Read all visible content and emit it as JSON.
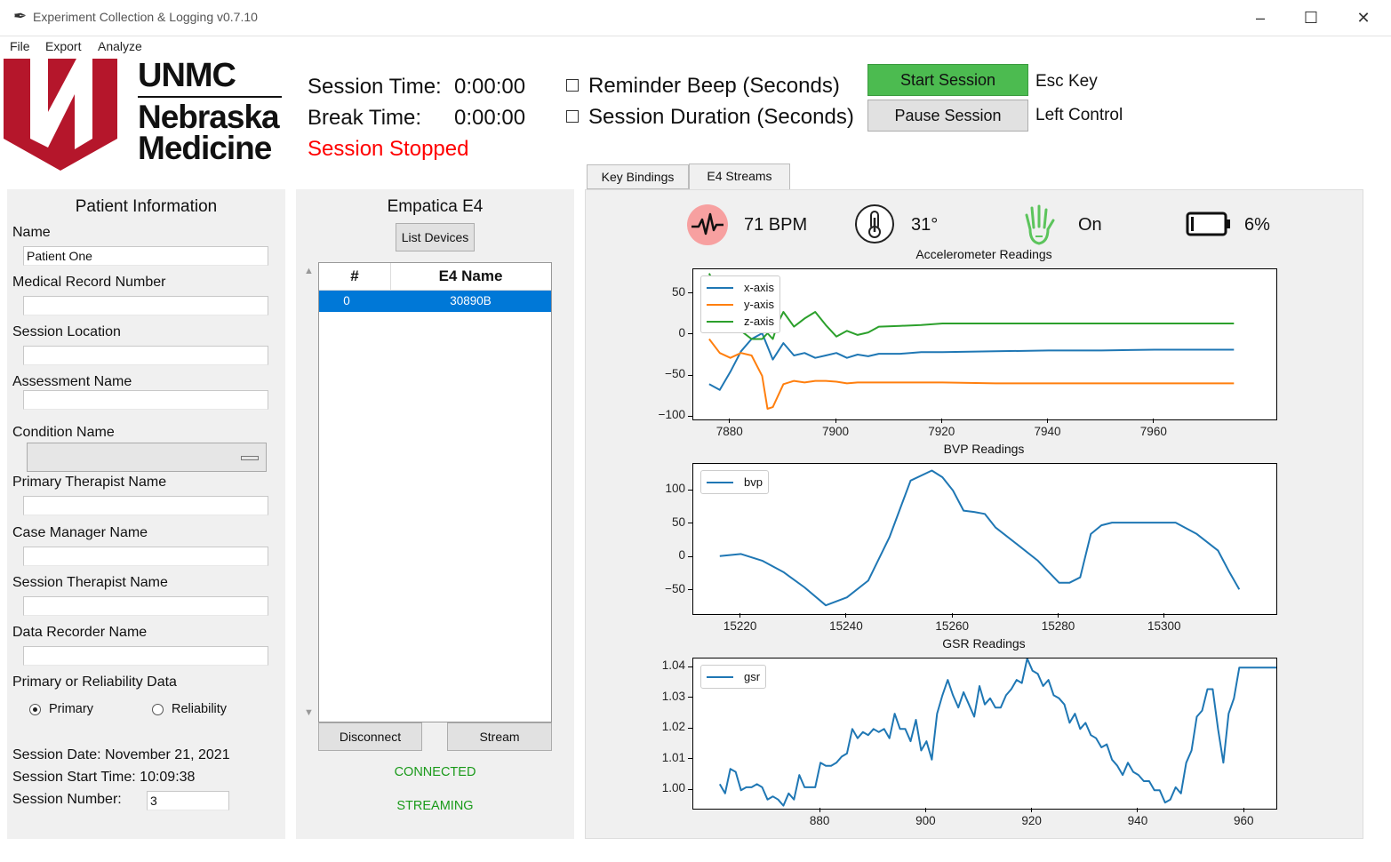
{
  "window": {
    "title": "Experiment Collection & Logging v0.7.10"
  },
  "menu": [
    "File",
    "Export",
    "Analyze"
  ],
  "logo": {
    "line1": "UNMC",
    "line2": "Nebraska",
    "line3": "Medicine",
    "color": "#b5162b"
  },
  "session": {
    "session_time_label": "Session Time:",
    "session_time_value": "0:00:00",
    "break_time_label": "Break Time:",
    "break_time_value": "0:00:00",
    "status": "Session Stopped",
    "status_color": "#ff0000",
    "reminder_beep_label": "Reminder Beep (Seconds)",
    "session_duration_label": "Session Duration (Seconds)",
    "start_button": "Start Session",
    "start_key": "Esc Key",
    "pause_button": "Pause Session",
    "pause_key": "Left Control",
    "start_color": "#4cbb50"
  },
  "patient": {
    "header": "Patient Information",
    "name_label": "Name",
    "name_value": "Patient One",
    "mrn_label": "Medical Record Number",
    "mrn_value": "",
    "location_label": "Session Location",
    "location_value": "",
    "assessment_label": "Assessment Name",
    "assessment_value": "",
    "condition_label": "Condition Name",
    "condition_value": "",
    "primary_therapist_label": "Primary Therapist Name",
    "primary_therapist_value": "",
    "case_manager_label": "Case Manager Name",
    "case_manager_value": "",
    "session_therapist_label": "Session Therapist Name",
    "session_therapist_value": "",
    "data_recorder_label": "Data Recorder Name",
    "data_recorder_value": "",
    "data_type_label": "Primary or Reliability Data",
    "radio_primary": "Primary",
    "radio_reliability": "Reliability",
    "selected": "Primary",
    "session_date": "Session Date: November 21, 2021",
    "session_start_time": "Session Start Time: 10:09:38",
    "session_number_label": "Session Number:",
    "session_number_value": "3"
  },
  "e4": {
    "header": "Empatica E4",
    "list_devices": "List Devices",
    "col_num": "#",
    "col_name": "E4 Name",
    "rows": [
      {
        "num": "0",
        "name": "30890B"
      }
    ],
    "disconnect": "Disconnect",
    "stream": "Stream",
    "status_connected": "CONNECTED",
    "status_streaming": "STREAMING",
    "status_color": "#1a9a1a"
  },
  "tabs": [
    "Key Bindings",
    "E4 Streams"
  ],
  "active_tab": "E4 Streams",
  "vitals": {
    "heart_rate": "71 BPM",
    "heart_icon": "heartbeat-icon",
    "temperature": "31°",
    "temp_icon": "thermometer-icon",
    "on_wrist": "On",
    "wrist_icon": "hand-icon",
    "battery": "6%",
    "battery_icon": "battery-icon"
  },
  "chart_data": [
    {
      "type": "line",
      "title": "Accelerometer Readings",
      "xlim": [
        7873,
        7983
      ],
      "ylim": [
        -103,
        80
      ],
      "xticks": [
        7880,
        7900,
        7920,
        7940,
        7960
      ],
      "yticks": [
        50,
        0,
        -50,
        -100
      ],
      "ytick_labels": [
        "50",
        "0",
        "−50",
        "−100"
      ],
      "legend": "top-left",
      "series": [
        {
          "name": "x-axis",
          "color": "#1f77b4",
          "x": [
            7876,
            7878,
            7880,
            7882,
            7884,
            7886,
            7888,
            7890,
            7892,
            7894,
            7896,
            7898,
            7900,
            7902,
            7904,
            7906,
            7908,
            7912,
            7916,
            7920,
            7930,
            7940,
            7950,
            7960,
            7970,
            7975
          ],
          "y": [
            -60,
            -67,
            -45,
            -20,
            -5,
            2,
            -30,
            -10,
            -25,
            -22,
            -28,
            -25,
            -22,
            -28,
            -24,
            -26,
            -23,
            -23,
            -21,
            -21,
            -20,
            -19,
            -19,
            -18,
            -18,
            -18
          ]
        },
        {
          "name": "y-axis",
          "color": "#ff7f0e",
          "x": [
            7876,
            7878,
            7880,
            7882,
            7884,
            7886,
            7887,
            7888,
            7890,
            7892,
            7894,
            7896,
            7898,
            7900,
            7902,
            7904,
            7910,
            7920,
            7930,
            7940,
            7950,
            7960,
            7970,
            7975
          ],
          "y": [
            -5,
            -22,
            -28,
            -22,
            -25,
            -50,
            -90,
            -88,
            -60,
            -56,
            -58,
            -56,
            -56,
            -57,
            -59,
            -58,
            -58,
            -58,
            -59,
            -59,
            -59,
            -59,
            -59,
            -59
          ]
        },
        {
          "name": "z-axis",
          "color": "#2ca02c",
          "x": [
            7876,
            7878,
            7880,
            7882,
            7884,
            7886,
            7887,
            7888,
            7889,
            7890,
            7892,
            7894,
            7896,
            7898,
            7900,
            7902,
            7904,
            7906,
            7908,
            7912,
            7916,
            7920,
            7930,
            7940,
            7950,
            7960,
            7970,
            7975
          ],
          "y": [
            75,
            45,
            20,
            5,
            -5,
            -5,
            2,
            -5,
            15,
            28,
            10,
            20,
            28,
            12,
            -2,
            5,
            0,
            3,
            10,
            11,
            12,
            14,
            14,
            14,
            14,
            14,
            14,
            14
          ]
        }
      ]
    },
    {
      "type": "line",
      "title": "BVP Readings",
      "xlim": [
        15211,
        15321
      ],
      "ylim": [
        -85,
        140
      ],
      "xticks": [
        15220,
        15240,
        15260,
        15280,
        15300
      ],
      "yticks": [
        100,
        50,
        0,
        -50
      ],
      "ytick_labels": [
        "100",
        "50",
        "0",
        "−50"
      ],
      "legend": "top-left",
      "series": [
        {
          "name": "bvp",
          "color": "#1f77b4",
          "x": [
            15216,
            15220,
            15224,
            15228,
            15232,
            15236,
            15240,
            15244,
            15248,
            15252,
            15256,
            15258,
            15260,
            15262,
            15264,
            15266,
            15268,
            15272,
            15276,
            15280,
            15282,
            15284,
            15286,
            15288,
            15290,
            15294,
            15298,
            15302,
            15306,
            15310,
            15312,
            15314
          ],
          "y": [
            2,
            5,
            -5,
            -22,
            -45,
            -72,
            -60,
            -35,
            30,
            115,
            130,
            120,
            100,
            70,
            68,
            65,
            45,
            20,
            -5,
            -38,
            -38,
            -30,
            35,
            48,
            52,
            52,
            52,
            52,
            35,
            10,
            -20,
            -48
          ]
        }
      ]
    },
    {
      "type": "line",
      "title": "GSR Readings",
      "xlim": [
        856,
        966
      ],
      "ylim": [
        0.994,
        1.043
      ],
      "xticks": [
        880,
        900,
        920,
        940,
        960
      ],
      "yticks": [
        1.04,
        1.03,
        1.02,
        1.01,
        1.0
      ],
      "ytick_labels": [
        "1.04",
        "1.03",
        "1.02",
        "1.01",
        "1.00"
      ],
      "legend": "top-left",
      "series": [
        {
          "name": "gsr",
          "color": "#1f77b4",
          "x": [
            861,
            862,
            863,
            864,
            865,
            866,
            867,
            868,
            869,
            870,
            871,
            872,
            873,
            874,
            875,
            876,
            877,
            878,
            879,
            880,
            881,
            882,
            883,
            884,
            885,
            886,
            887,
            888,
            889,
            890,
            891,
            892,
            893,
            894,
            895,
            896,
            897,
            898,
            899,
            900,
            901,
            902,
            903,
            904,
            905,
            906,
            907,
            908,
            909,
            910,
            911,
            912,
            913,
            914,
            915,
            916,
            917,
            918,
            919,
            920,
            921,
            922,
            923,
            924,
            925,
            926,
            927,
            928,
            929,
            930,
            931,
            932,
            933,
            934,
            935,
            936,
            937,
            938,
            939,
            940,
            941,
            942,
            943,
            944,
            945,
            946,
            947,
            948,
            949,
            950,
            951,
            952,
            953,
            954,
            955,
            956,
            957,
            958,
            959,
            960,
            961,
            962,
            963,
            964,
            965,
            966
          ],
          "y": [
            1.002,
            0.999,
            1.007,
            1.006,
            1.0,
            1.001,
            1.001,
            1.002,
            1.001,
            0.997,
            0.998,
            0.997,
            0.995,
            0.999,
            0.997,
            1.005,
            1.001,
            1.001,
            1.001,
            1.009,
            1.008,
            1.008,
            1.009,
            1.011,
            1.012,
            1.02,
            1.017,
            1.019,
            1.018,
            1.02,
            1.019,
            1.02,
            1.017,
            1.025,
            1.02,
            1.02,
            1.016,
            1.023,
            1.013,
            1.016,
            1.01,
            1.025,
            1.031,
            1.036,
            1.031,
            1.027,
            1.032,
            1.028,
            1.024,
            1.034,
            1.028,
            1.03,
            1.027,
            1.027,
            1.031,
            1.033,
            1.036,
            1.035,
            1.043,
            1.039,
            1.038,
            1.034,
            1.036,
            1.031,
            1.03,
            1.028,
            1.022,
            1.025,
            1.02,
            1.022,
            1.018,
            1.017,
            1.014,
            1.015,
            1.01,
            1.008,
            1.005,
            1.009,
            1.006,
            1.005,
            1.003,
            1.003,
            1.0,
            1.0,
            0.996,
            0.997,
            1.001,
            0.999,
            1.009,
            1.013,
            1.024,
            1.026,
            1.033,
            1.033,
            1.02,
            1.009,
            1.025,
            1.03,
            1.04,
            1.04,
            1.04,
            1.04,
            1.04,
            1.04,
            1.04,
            1.04
          ]
        }
      ]
    }
  ]
}
